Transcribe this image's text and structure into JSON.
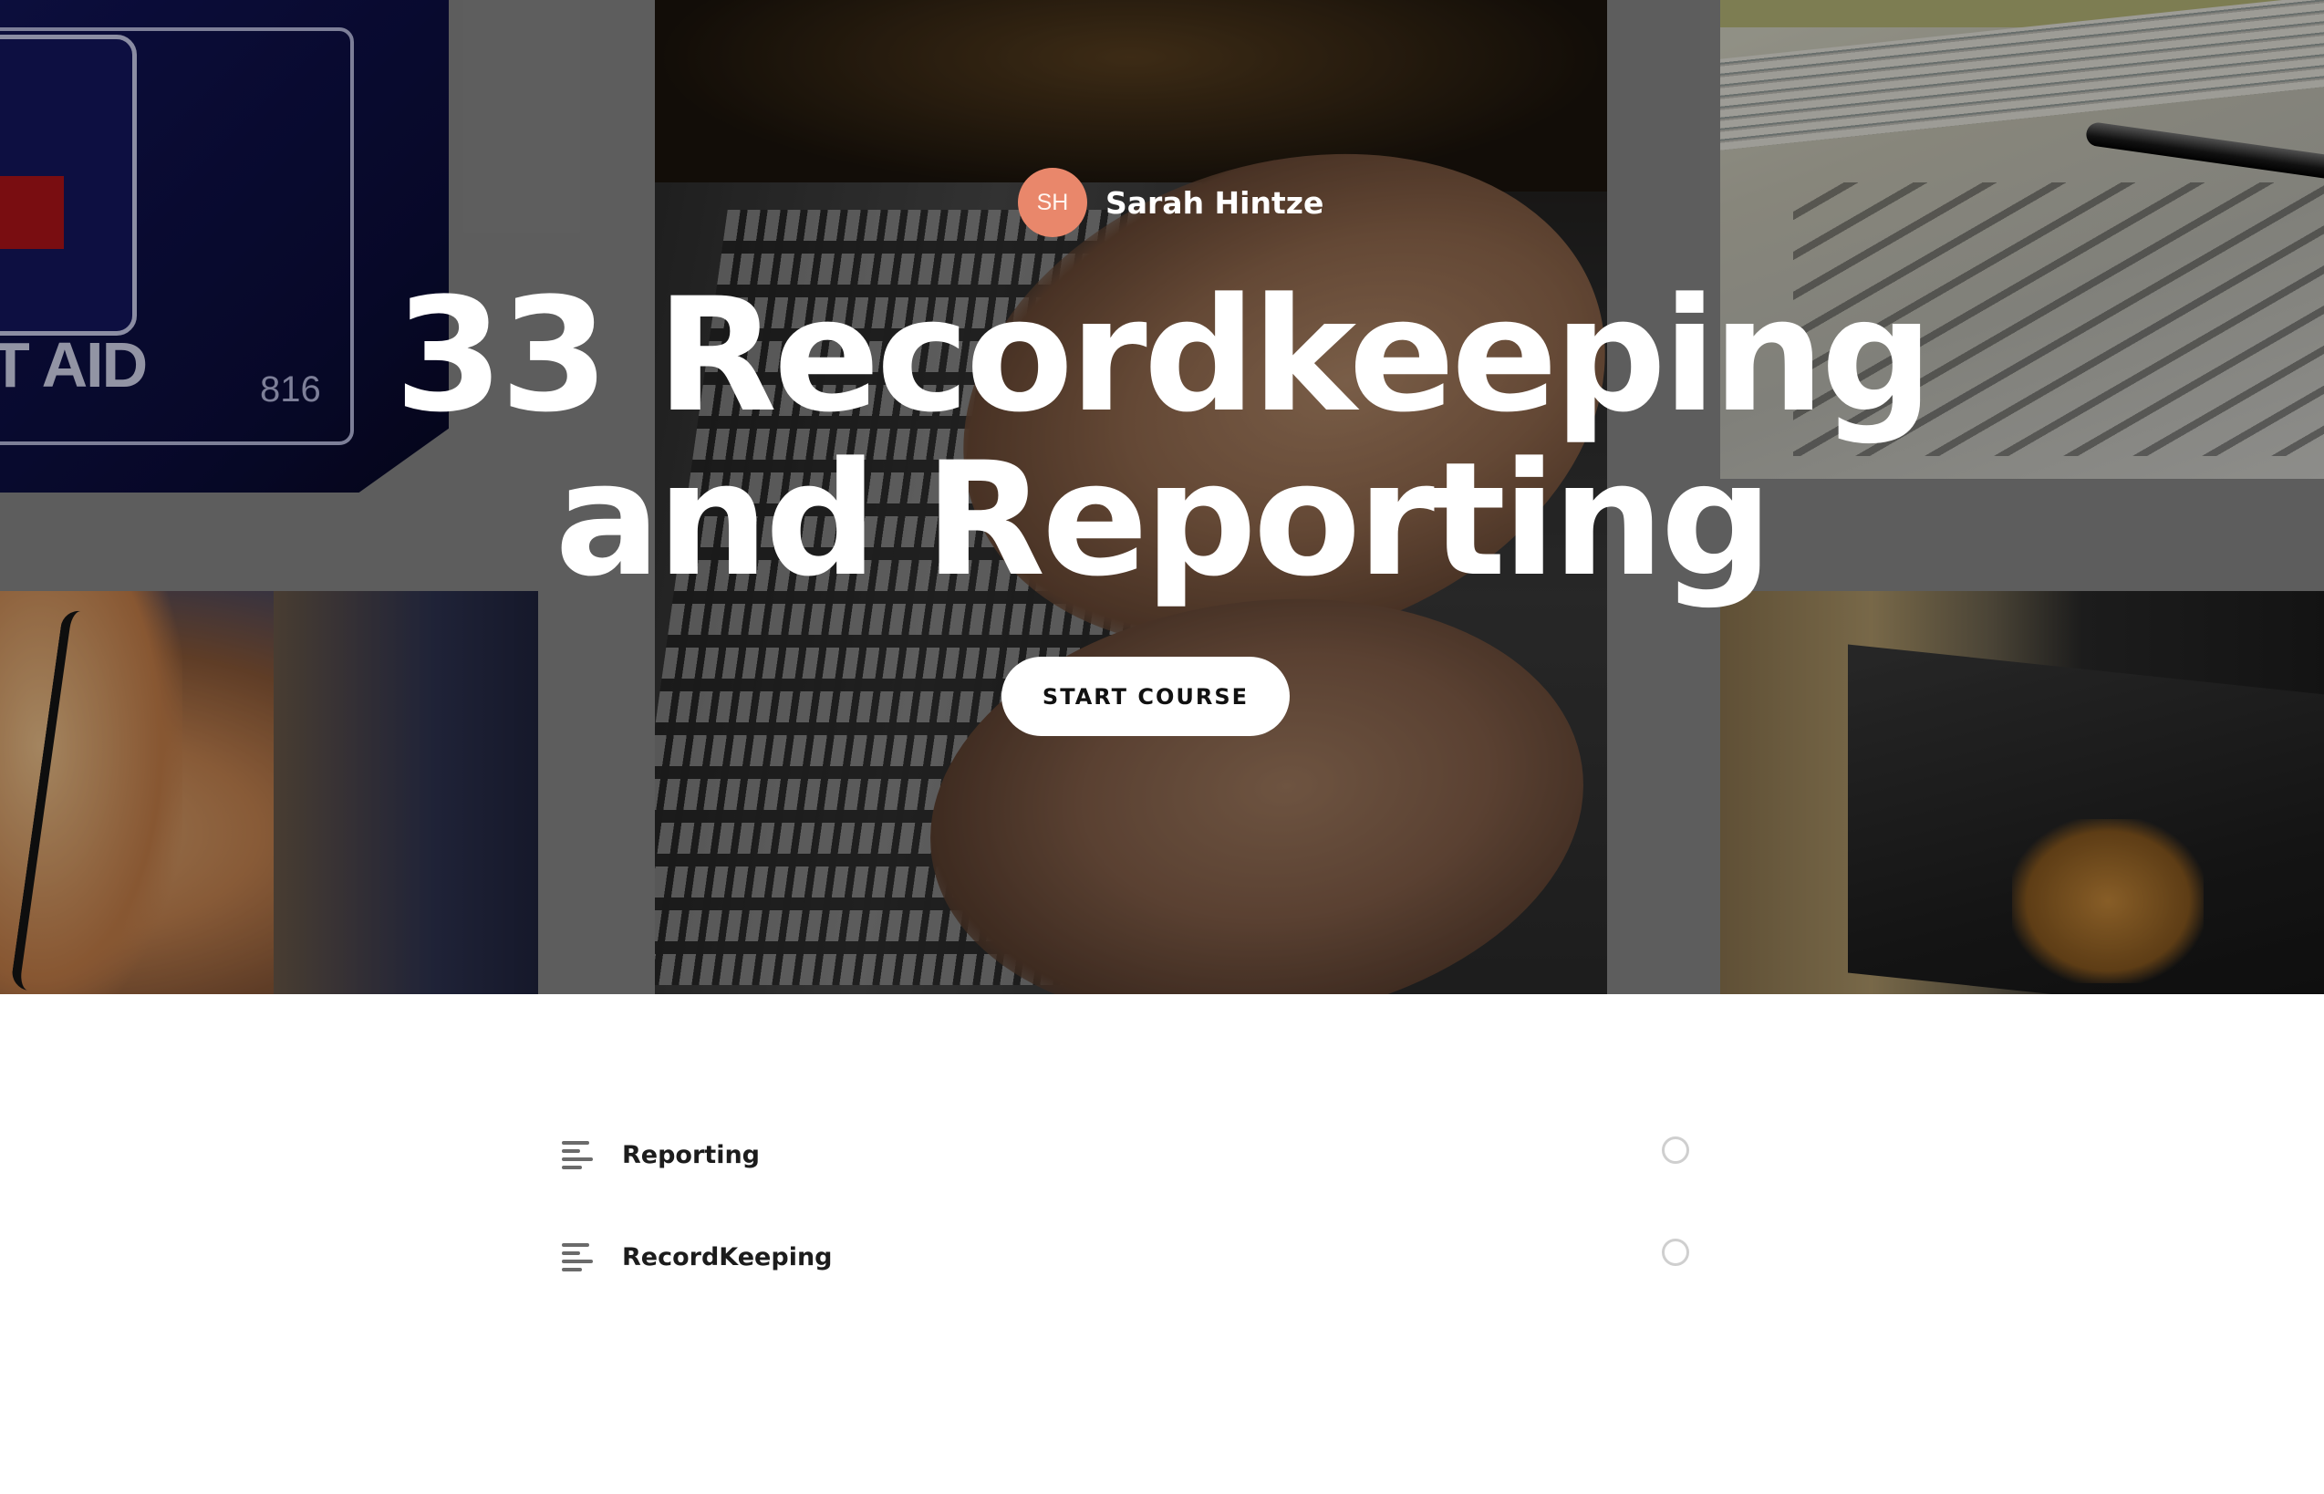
{
  "course": {
    "author": {
      "initials": "SH",
      "name": "Sarah Hintze",
      "avatar_color": "#e9876b"
    },
    "title_lines": [
      "33 Recordkeeping",
      "and Reporting"
    ],
    "start_label": "START COURSE"
  },
  "hero_images": {
    "firstaid_text": "T AID",
    "firstaid_number": "816"
  },
  "lessons": [
    {
      "title": "Reporting",
      "icon": "text-lines-icon",
      "status": "incomplete"
    },
    {
      "title": "RecordKeeping",
      "icon": "text-lines-icon",
      "status": "incomplete"
    }
  ],
  "colors": {
    "avatar": "#e9876b",
    "button_bg": "#ffffff",
    "status_ring": "#cfcfcf"
  }
}
